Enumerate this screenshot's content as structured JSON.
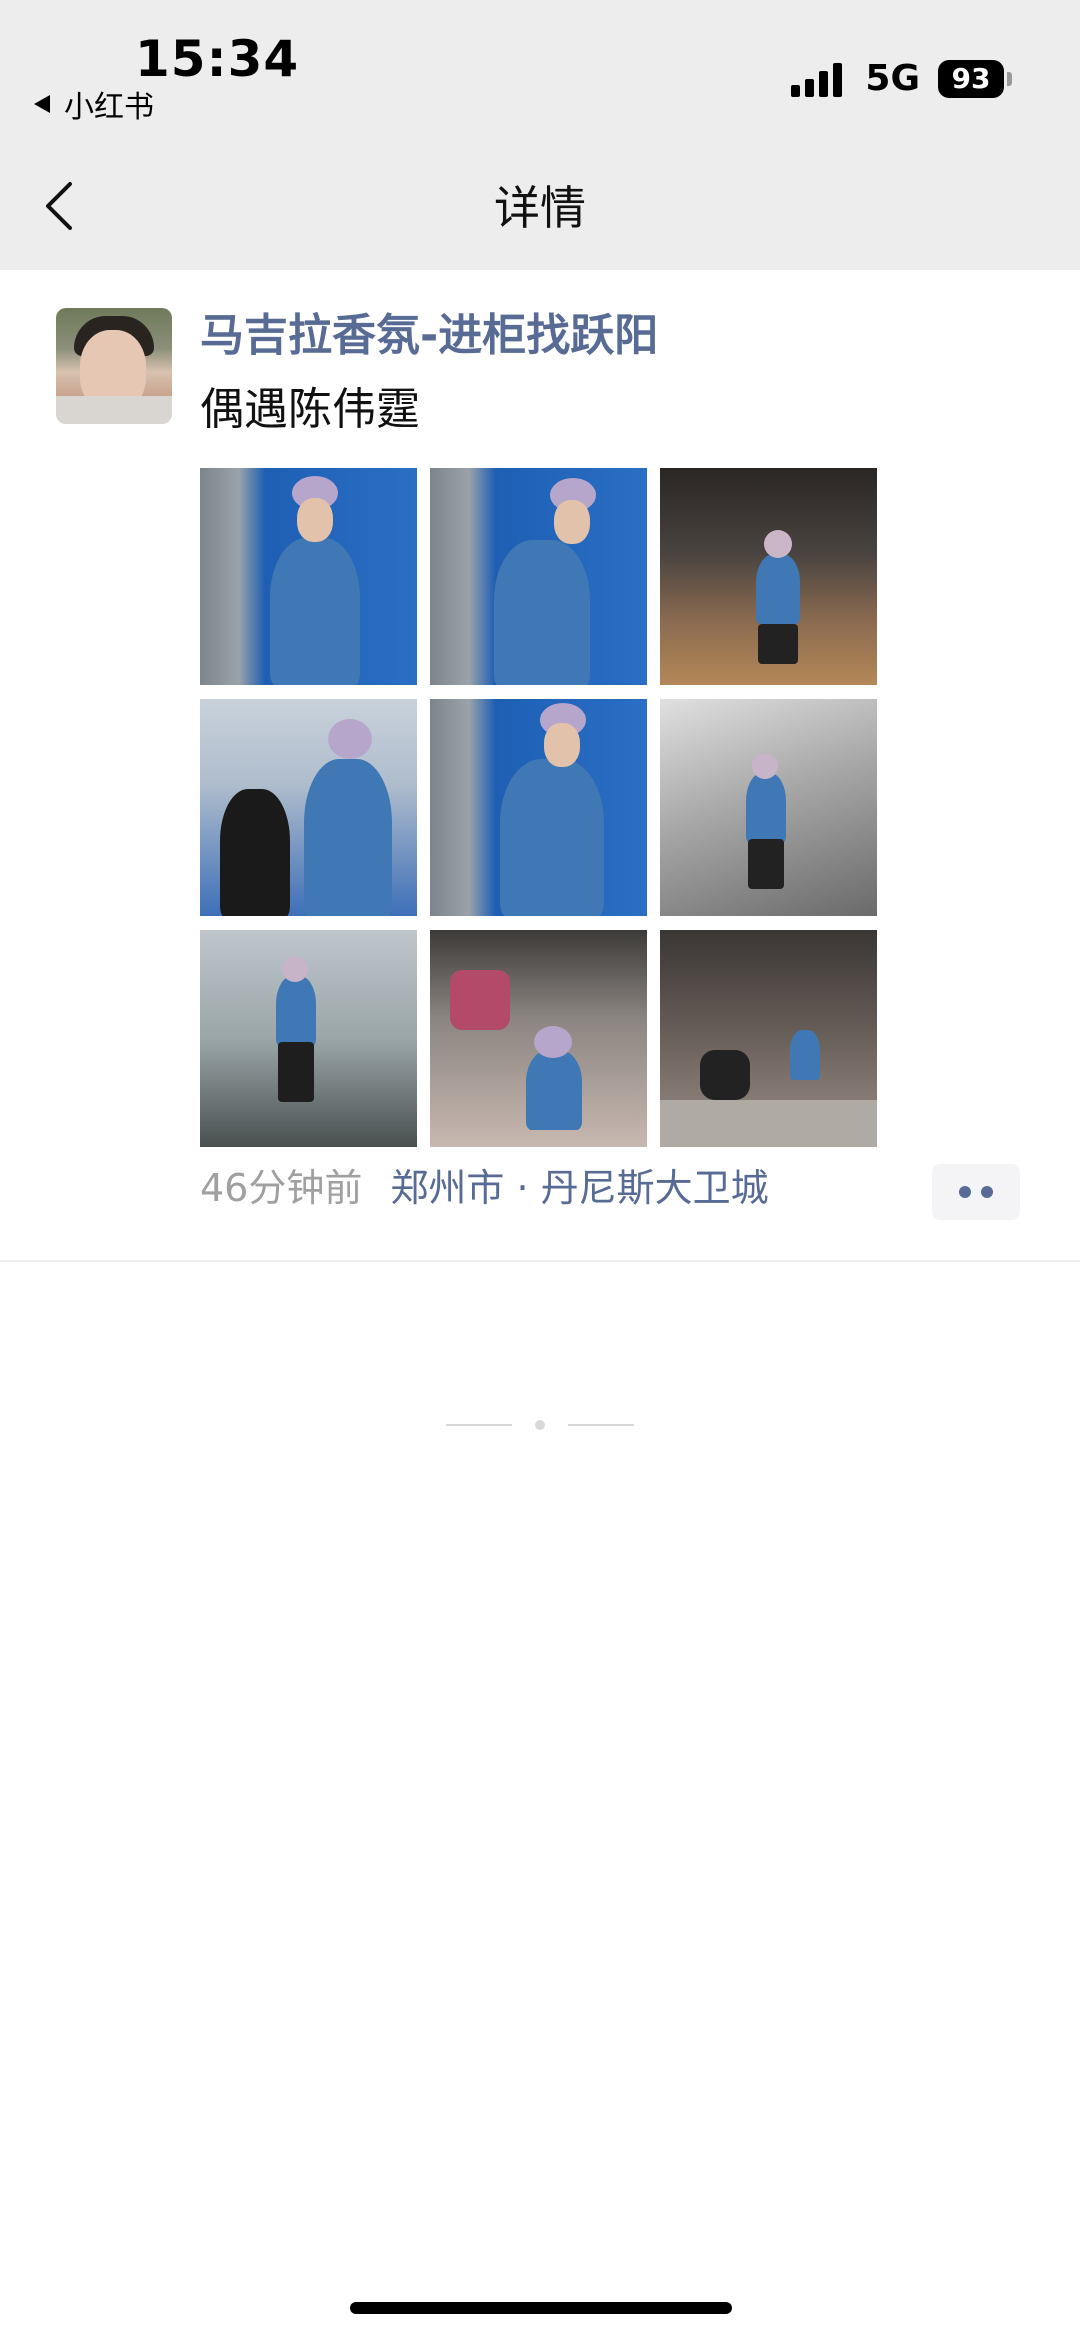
{
  "status_bar": {
    "time": "15:34",
    "back_app_label": "小红书",
    "network": "5G",
    "battery": "93",
    "icons": [
      "back-triangle-icon",
      "signal-icon",
      "battery-icon"
    ]
  },
  "nav": {
    "title": "详情",
    "back_icon": "chevron-left-icon"
  },
  "post": {
    "username": "马吉拉香氛-进柜找跃阳",
    "text": "偶遇陈伟霆",
    "time_ago": "46分钟前",
    "location": "郑州市 · 丹尼斯大卫城",
    "photo_count": 9
  },
  "colors": {
    "link": "#576b95",
    "header_bg": "#ededed",
    "meta_grey": "#a0a0a0"
  }
}
